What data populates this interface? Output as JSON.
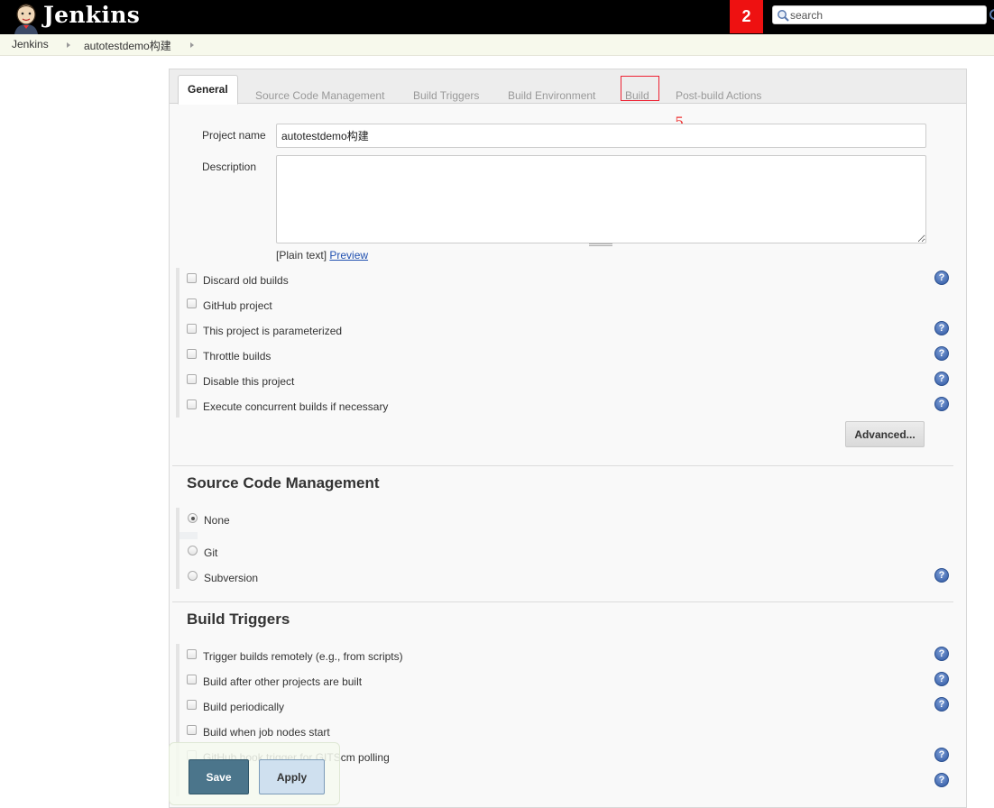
{
  "header": {
    "brand": "Jenkins",
    "notification_count": "2",
    "search_placeholder": "search"
  },
  "breadcrumb": [
    "Jenkins",
    "autotestdemo构建"
  ],
  "tabs": [
    {
      "label": "General",
      "active": true
    },
    {
      "label": "Source Code Management"
    },
    {
      "label": "Build Triggers"
    },
    {
      "label": "Build Environment"
    },
    {
      "label": "Build",
      "highlighted": true
    },
    {
      "label": "Post-build Actions"
    }
  ],
  "annotation": "5",
  "general": {
    "project_name_label": "Project name",
    "project_name_value": "autotestdemo构建",
    "description_label": "Description",
    "description_value": "",
    "format_note": "[Plain text]",
    "preview_link": "Preview",
    "options": [
      "Discard old builds",
      "GitHub project",
      "This project is parameterized",
      "Throttle builds",
      "Disable this project",
      "Execute concurrent builds if necessary"
    ],
    "advanced_button": "Advanced..."
  },
  "scm": {
    "title": "Source Code Management",
    "options": [
      "None",
      "Git",
      "Subversion"
    ],
    "selected": "None"
  },
  "triggers": {
    "title": "Build Triggers",
    "options": [
      "Trigger builds remotely (e.g., from scripts)",
      "Build after other projects are built",
      "Build periodically",
      "Build when job nodes start",
      "GitHub hook trigger for GITScm polling"
    ]
  },
  "footer": {
    "save": "Save",
    "apply": "Apply"
  },
  "colors": {
    "header_bg": "#000000",
    "badge_bg": "#ee1111",
    "save_bg": "#4b758b",
    "apply_bg": "#cfe0ef",
    "highlight": "#ee2233"
  }
}
